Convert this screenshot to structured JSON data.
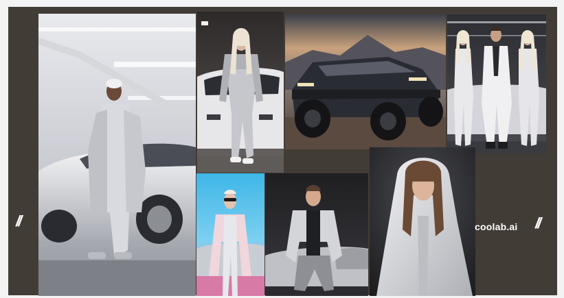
{
  "brand": {
    "logo_text": "coolab.ai",
    "left_mark": "//",
    "right_mark": "//"
  },
  "colors": {
    "board_background": "#423c36",
    "page_background": "#f3f3f3"
  },
  "photos": [
    {
      "subject": "man-in-silver-coat-with-white-car"
    },
    {
      "subject": "woman-in-silver-outfit-with-car"
    },
    {
      "subject": "futuristic-off-road-truck"
    },
    {
      "subject": "group-of-three-in-white-suits"
    },
    {
      "subject": "woman-in-sunglasses-pink-coat"
    },
    {
      "subject": "man-in-grey-jacket-seated"
    },
    {
      "subject": "woman-in-white-hoodie"
    }
  ]
}
